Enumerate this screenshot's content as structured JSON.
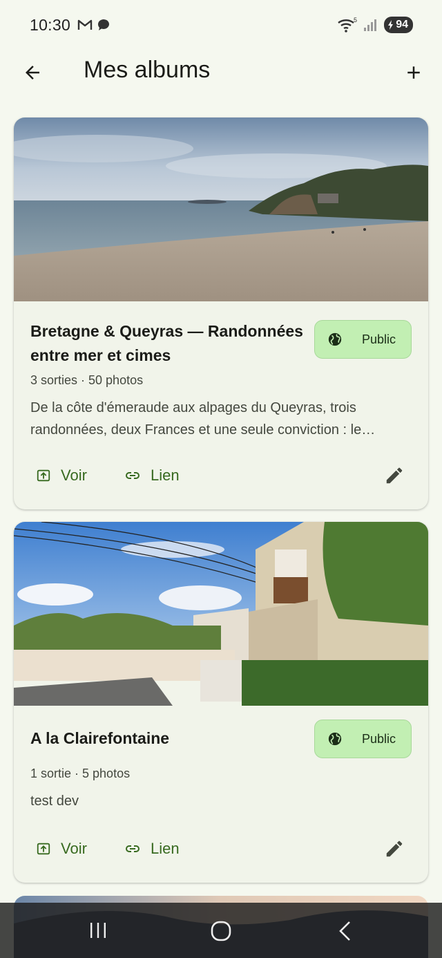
{
  "status": {
    "time": "10:30",
    "battery": "94",
    "icons": [
      "gmail-icon",
      "chat-bubble-icon",
      "wifi-icon",
      "signal-icon",
      "battery-charging-icon"
    ]
  },
  "app_bar": {
    "title": "Mes albums",
    "back_icon": "arrow-back-icon",
    "add_icon": "add-icon"
  },
  "albums": [
    {
      "title": "Bretagne & Queyras — Randonnées entre mer et cimes",
      "badge": "Public",
      "meta": "3 sorties · 50 photos",
      "description": "De la côte d'émeraude aux alpages du Queyras, trois randonnées, deux Frances et une seule conviction : le…",
      "desc_line1": "De la côte d'émeraude aux alpages du Queyras, trois",
      "desc_line2": "randonnées, deux Frances et une seule conviction : le…",
      "view_label": "Voir",
      "link_label": "Lien"
    },
    {
      "title": "A la Clairefontaine",
      "badge": "Public",
      "meta": "1 sortie · 5 photos",
      "description": "test dev",
      "view_label": "Voir",
      "link_label": "Lien"
    }
  ],
  "colors": {
    "background": "#f5f8ef",
    "card": "#f1f4ea",
    "accent": "#386a20",
    "badge_bg": "#c2efb3"
  }
}
